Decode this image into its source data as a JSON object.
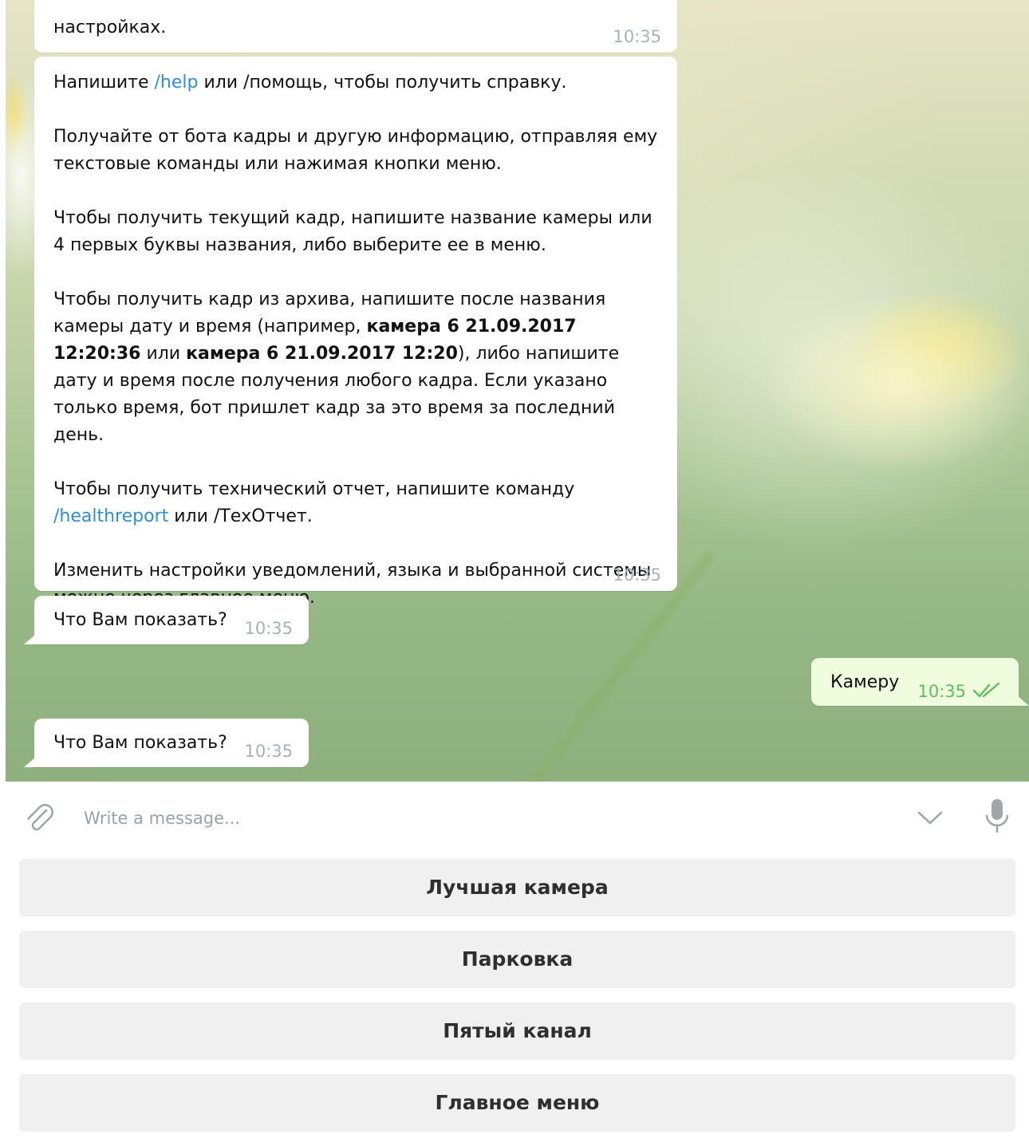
{
  "messages": {
    "m1": {
      "text": "настройках.",
      "time": "10:35"
    },
    "m2": {
      "p1_pre": "Напишите ",
      "p1_link": "/help",
      "p1_post": " или /помощь, чтобы получить справку.",
      "p2": "Получайте от бота кадры и другую информацию, отправляя ему текстовые команды или нажимая кнопки меню.",
      "p3": "Чтобы получить текущий кадр, напишите название камеры или 4 первых буквы названия, либо выберите ее в меню.",
      "p4_pre": "Чтобы получить кадр из архива, напишите после названия камеры дату и время (например, ",
      "p4_bold1": "камера 6 21.09.2017 12:20:36",
      "p4_mid": " или ",
      "p4_bold2": "камера 6 21.09.2017 12:20",
      "p4_post": "), либо напишите дату и время после получения любого кадра. Если указано только время, бот пришлет кадр за это время за последний день.",
      "p5_pre": "Чтобы получить технический отчет, напишите команду ",
      "p5_link": "/healthreport",
      "p5_post": " или /ТехОтчет.",
      "p6": "Изменить настройки уведомлений, языка и выбранной системы можно через главное меню.",
      "time": "10:35"
    },
    "m3": {
      "text": "Что Вам показать?",
      "time": "10:35"
    },
    "m4": {
      "text": "Камеру",
      "time": "10:35",
      "status_icon": "double-check-icon"
    },
    "m5": {
      "text": "Что Вам показать?",
      "time": "10:35"
    }
  },
  "composer": {
    "placeholder": "Write a message...",
    "attach_icon": "paperclip-icon",
    "hide_keyboard_icon": "chevron-down-icon",
    "mic_icon": "microphone-icon"
  },
  "keyboard": {
    "buttons": [
      "Лучшая камера",
      "Парковка",
      "Пятый канал",
      "Главное меню"
    ]
  },
  "colors": {
    "link": "#2f8ed6",
    "outgoing_bubble": "#effdde",
    "outgoing_time": "#5cbf5a",
    "keyboard_button": "#f0f0f0"
  }
}
